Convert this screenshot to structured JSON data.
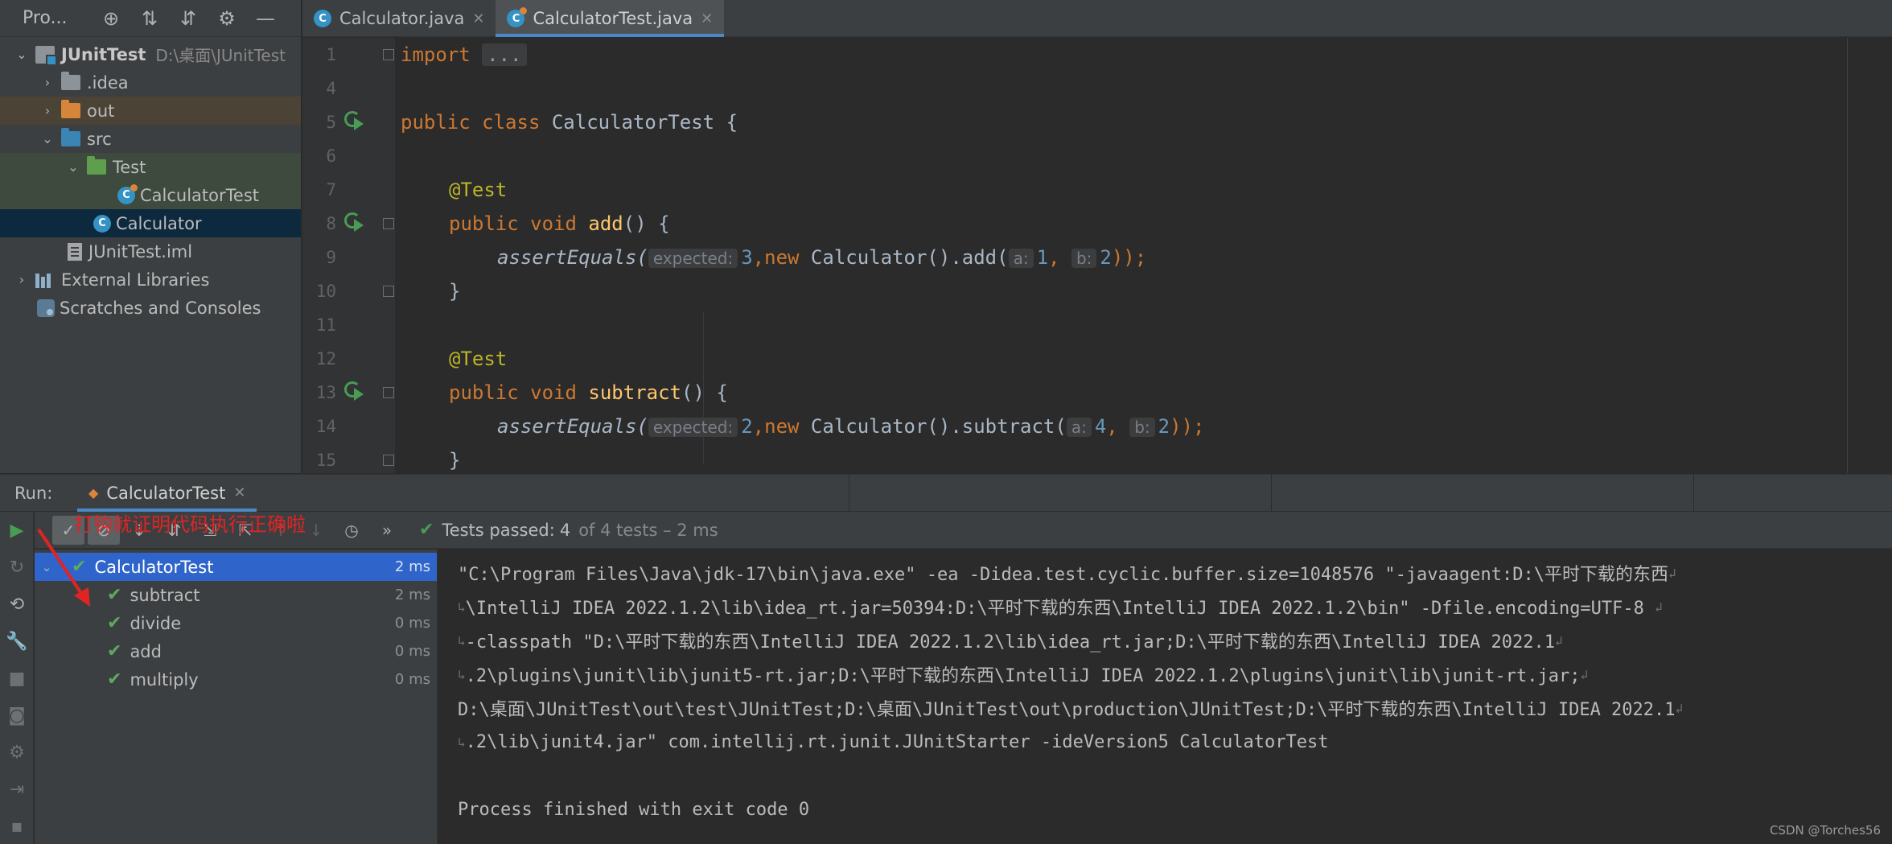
{
  "project_panel": {
    "title": "Pro...",
    "tree": [
      {
        "label": "JUnitTest",
        "note": "D:\\桌面\\JUnitTest"
      },
      {
        "label": ".idea"
      },
      {
        "label": "out"
      },
      {
        "label": "src"
      },
      {
        "label": "Test"
      },
      {
        "label": "CalculatorTest"
      },
      {
        "label": "Calculator"
      },
      {
        "label": "JUnitTest.iml"
      },
      {
        "label": "External Libraries"
      },
      {
        "label": "Scratches and Consoles"
      }
    ]
  },
  "editor": {
    "tabs": [
      {
        "label": "Calculator.java",
        "icon": "C"
      },
      {
        "label": "CalculatorTest.java",
        "icon": "C"
      }
    ],
    "line_numbers": [
      "1",
      "4",
      "5",
      "6",
      "7",
      "8",
      "9",
      "10",
      "11",
      "12",
      "13",
      "14",
      "15"
    ],
    "code": {
      "l1_kw": "import",
      "l1_fold": "...",
      "l5_kw": "public class",
      "l5_rest": " CalculatorTest {",
      "l7_ann": "@Test",
      "l8_kw": "public void",
      "l8_fn": "add",
      "l8_rest": "() {",
      "l9_fn": "assertEquals(",
      "l9_hint1": "expected:",
      "l9_n1": "3",
      "l9_kw": "new",
      "l9_mid": " Calculator().add(",
      "l9_hint2": "a:",
      "l9_n2": "1",
      "l9_hint3": "b:",
      "l9_n3": "2",
      "l9_end": "));",
      "l10": "}",
      "l12_ann": "@Test",
      "l13_kw": "public void",
      "l13_fn": "subtract",
      "l13_rest": "() {",
      "l14_fn": "assertEquals(",
      "l14_hint1": "expected:",
      "l14_n1": "2",
      "l14_kw": "new",
      "l14_mid": " Calculator().subtract(",
      "l14_hint2": "a:",
      "l14_n2": "4",
      "l14_hint3": "b:",
      "l14_n3": "2",
      "l14_end": "));",
      "l15": "}"
    }
  },
  "run": {
    "label": "Run:",
    "tab": "CalculatorTest",
    "status": {
      "prefix": "Tests passed:",
      "count": "4",
      "suffix": "of 4 tests – 2 ms"
    },
    "tests": [
      {
        "name": "CalculatorTest",
        "time": "2 ms"
      },
      {
        "name": "subtract",
        "time": "2 ms"
      },
      {
        "name": "divide",
        "time": "0 ms"
      },
      {
        "name": "add",
        "time": "0 ms"
      },
      {
        "name": "multiply",
        "time": "0 ms"
      }
    ],
    "console": [
      "\"C:\\Program Files\\Java\\jdk-17\\bin\\java.exe\" -ea -Didea.test.cyclic.buffer.size=1048576 \"-javaagent:D:\\平时下载的东西",
      "\\IntelliJ IDEA 2022.1.2\\lib\\idea_rt.jar=50394:D:\\平时下载的东西\\IntelliJ IDEA 2022.1.2\\bin\" -Dfile.encoding=UTF-8 ",
      "-classpath \"D:\\平时下载的东西\\IntelliJ IDEA 2022.1.2\\lib\\idea_rt.jar;D:\\平时下载的东西\\IntelliJ IDEA 2022.1",
      ".2\\plugins\\junit\\lib\\junit5-rt.jar;D:\\平时下载的东西\\IntelliJ IDEA 2022.1.2\\plugins\\junit\\lib\\junit-rt.jar;",
      "D:\\桌面\\JUnitTest\\out\\test\\JUnitTest;D:\\桌面\\JUnitTest\\out\\production\\JUnitTest;D:\\平时下载的东西\\IntelliJ IDEA 2022.1",
      ".2\\lib\\junit4.jar\" com.intellij.rt.junit.JUnitStarter -ideVersion5 CalculatorTest",
      "",
      "Process finished with exit code 0"
    ]
  },
  "annotation": "打钩就证明代码执行正确啦",
  "watermark": "CSDN @Torches56",
  "colors": {
    "accent": "#4a88c7",
    "pass_green": "#499c54",
    "selection": "#2f65ca",
    "annotation_red": "#e02424"
  }
}
